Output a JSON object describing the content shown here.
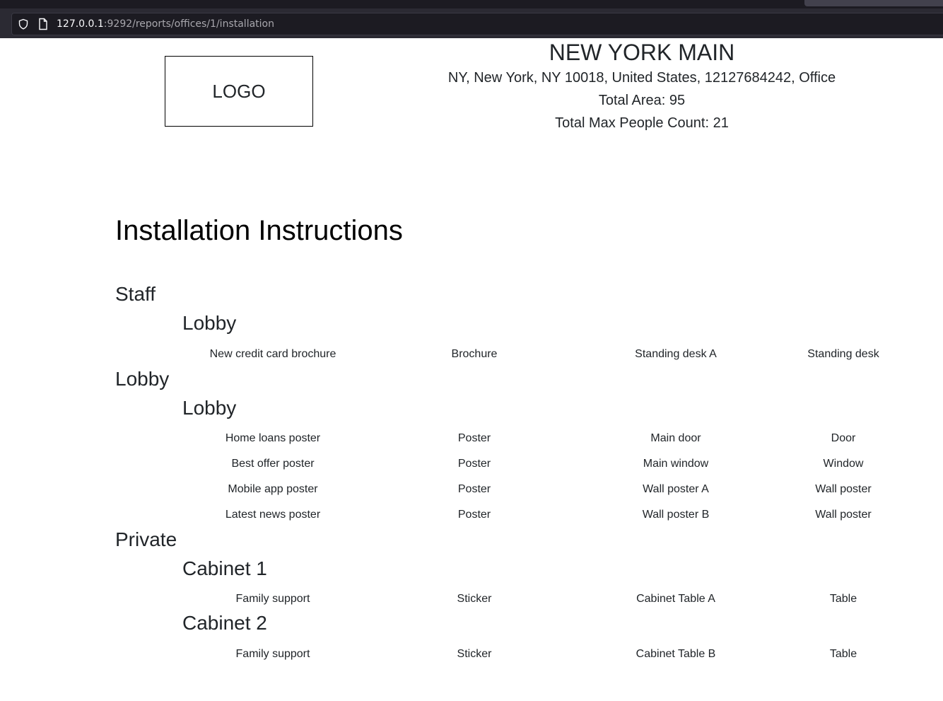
{
  "browser": {
    "url_host": "127.0.0.1",
    "url_path": ":9292/reports/offices/1/installation"
  },
  "header": {
    "logo_text": "LOGO",
    "office_name": "NEW YORK MAIN",
    "address_line": "NY, New York, NY 10018, United States, 12127684242, Office",
    "total_area": "Total Area: 95",
    "total_max_people": "Total Max People Count: 21"
  },
  "page": {
    "title": "Installation Instructions"
  },
  "categories": [
    {
      "name": "Staff",
      "rooms": [
        {
          "name": "Lobby",
          "items": [
            [
              "New credit card brochure",
              "Brochure",
              "Standing desk A",
              "Standing desk"
            ]
          ]
        }
      ]
    },
    {
      "name": "Lobby",
      "rooms": [
        {
          "name": "Lobby",
          "items": [
            [
              "Home loans poster",
              "Poster",
              "Main door",
              "Door"
            ],
            [
              "Best offer poster",
              "Poster",
              "Main window",
              "Window"
            ],
            [
              "Mobile app poster",
              "Poster",
              "Wall poster A",
              "Wall poster"
            ],
            [
              "Latest news poster",
              "Poster",
              "Wall poster B",
              "Wall poster"
            ]
          ]
        }
      ]
    },
    {
      "name": "Private",
      "rooms": [
        {
          "name": "Cabinet 1",
          "items": [
            [
              "Family support",
              "Sticker",
              "Cabinet Table A",
              "Table"
            ]
          ]
        },
        {
          "name": "Cabinet 2",
          "items": [
            [
              "Family support",
              "Sticker",
              "Cabinet Table B",
              "Table"
            ]
          ]
        }
      ]
    }
  ]
}
